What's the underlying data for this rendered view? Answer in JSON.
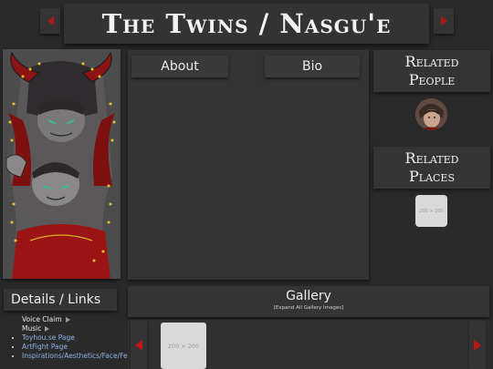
{
  "header": {
    "title": "The Twins / Nasgu'e"
  },
  "tabs": [
    {
      "label": "About"
    },
    {
      "label": "Bio"
    }
  ],
  "related": {
    "people_heading_line1": "Related",
    "people_heading_line2": "People",
    "places_heading_line1": "Related",
    "places_heading_line2": "Places",
    "place_placeholder": "200 × 200"
  },
  "details": {
    "heading": "Details / Links",
    "toggles": [
      {
        "label": "Voice Claim"
      },
      {
        "label": "Music"
      }
    ],
    "links": [
      {
        "label": "Toyhou.se Page"
      },
      {
        "label": "ArtFight Page"
      },
      {
        "label": "Inspirations/Aesthetics/Face/Features"
      }
    ]
  },
  "gallery": {
    "title": "Gallery",
    "expand_label": "[Expand All Gallery Images]",
    "placeholder": "200 × 200"
  },
  "colors": {
    "background": "#2b2a2a",
    "panel": "#353434",
    "accent": "#b01616",
    "link": "#8fb3e8"
  },
  "icons": {
    "nav_prev": "triangle-left-icon",
    "nav_next": "triangle-right-icon",
    "toggle": "triangle-right-icon"
  }
}
